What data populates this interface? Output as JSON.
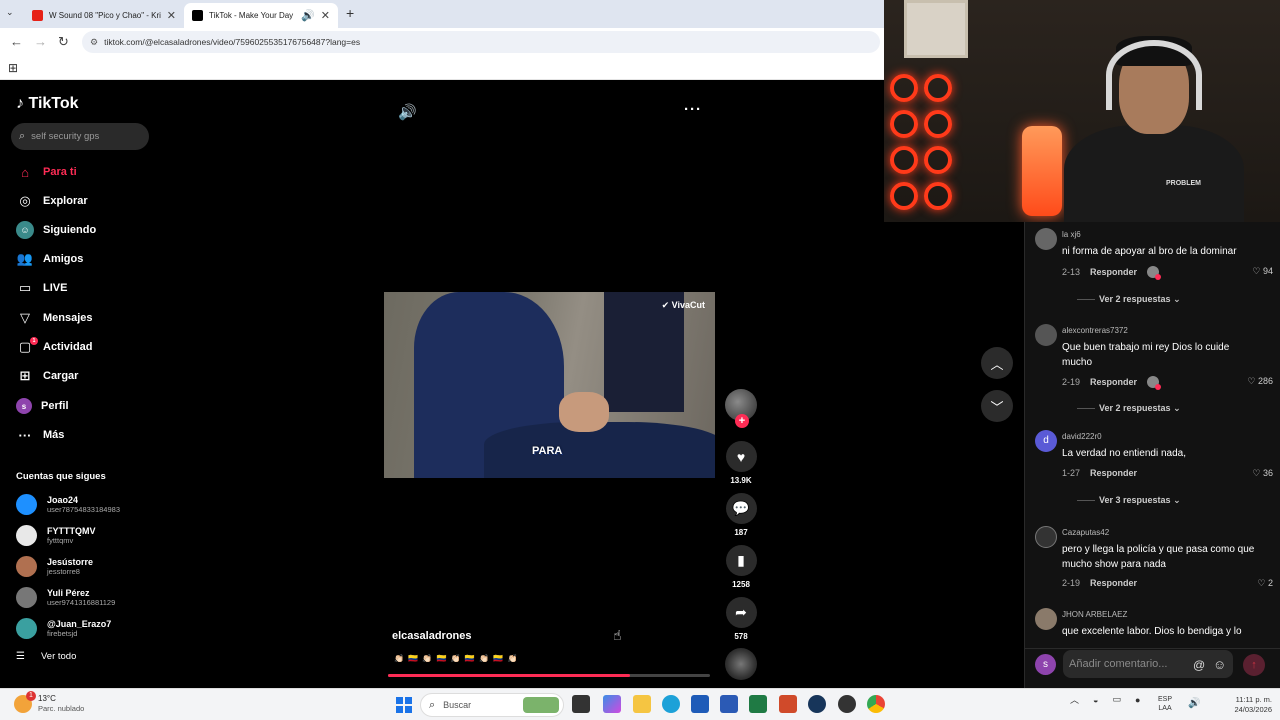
{
  "browser": {
    "tabs": [
      {
        "title": "W Sound 08 \"Pico y Chao\" - Kri",
        "active": false,
        "favicon_color": "#e62117"
      },
      {
        "title": "TikTok - Make Your Day",
        "active": true,
        "favicon_color": "#000000"
      }
    ],
    "url": "tiktok.com/@elcasaladrones/video/7596025535176756487?lang=es"
  },
  "sidebar": {
    "logo": "TikTok",
    "search_placeholder": "self security gps",
    "nav": [
      {
        "label": "Para ti",
        "icon": "home-icon",
        "active": true
      },
      {
        "label": "Explorar",
        "icon": "compass-icon"
      },
      {
        "label": "Siguiendo",
        "icon": "following-icon"
      },
      {
        "label": "Amigos",
        "icon": "friends-icon"
      },
      {
        "label": "LIVE",
        "icon": "live-icon"
      },
      {
        "label": "Mensajes",
        "icon": "messages-icon"
      },
      {
        "label": "Actividad",
        "icon": "activity-icon",
        "badge": "1"
      },
      {
        "label": "Cargar",
        "icon": "upload-icon"
      },
      {
        "label": "Perfil",
        "icon": "profile-icon",
        "avatar_letter": "s"
      },
      {
        "label": "Más",
        "icon": "more-icon"
      }
    ],
    "following_title": "Cuentas que sigues",
    "following": [
      {
        "name": "Joao24",
        "handle": "user78754833184983",
        "color": "#1e90ff"
      },
      {
        "name": "FYTTTQMV",
        "handle": "fytttqmv",
        "color": "#e8e8e8"
      },
      {
        "name": "Jesústorre",
        "handle": "jesstorre8",
        "color": "#b07050"
      },
      {
        "name": "Yuli Pérez",
        "handle": "user9741316881129",
        "color": "#777777"
      },
      {
        "name": "@Juan_Erazo7",
        "handle": "firebetsjd",
        "color": "#3aa0a0"
      }
    ],
    "see_all": "Ver todo"
  },
  "video": {
    "watermark": "VivaCut",
    "caption": "PARA",
    "creator": "elcasaladrones",
    "description": "👏🏻 🇨🇴 👏🏻 🇨🇴 👏🏻 🇨🇴 👏🏻 🇨🇴 👏🏻",
    "progress": 0.75
  },
  "actions": {
    "likes": "13.9K",
    "comments": "187",
    "saves": "1258",
    "shares": "578"
  },
  "comments": [
    {
      "user": "la xj6",
      "text": "ni forma de apoyar al bro de la dominar",
      "date": "2-13",
      "likes": "94",
      "more": "Ver 2 respuestas",
      "color": "#666"
    },
    {
      "user": "alexcontreras7372",
      "text": "Que buen trabajo mi rey Dios lo cuide mucho",
      "date": "2-19",
      "likes": "286",
      "more": "Ver 2 respuestas",
      "color": "#555"
    },
    {
      "user": "david222r0",
      "text": "La verdad no entiendi nada,",
      "date": "1-27",
      "likes": "36",
      "more": "Ver 3 respuestas",
      "color": "#5a5ad6",
      "letter": "d"
    },
    {
      "user": "Cazaputas42",
      "text": "pero y llega la policía y que pasa como que mucho show para nada",
      "date": "2-19",
      "likes": "2",
      "color": "#333"
    },
    {
      "user": "JHON ARBELAEZ",
      "text": "que excelente labor. Dios lo bendiga y lo",
      "color": "#8a7a6a"
    }
  ],
  "comment_labels": {
    "reply": "Responder",
    "placeholder": "Añadir comentario...",
    "my_avatar": "s"
  },
  "taskbar": {
    "temp": "13°C",
    "weather": "Parc. nublado",
    "search": "Buscar",
    "lang1": "ESP",
    "lang2": "LAA",
    "time": "11:11 p. m.",
    "date": "24/03/2026"
  },
  "webcam": {
    "shirt_text": "PROBLEM"
  }
}
